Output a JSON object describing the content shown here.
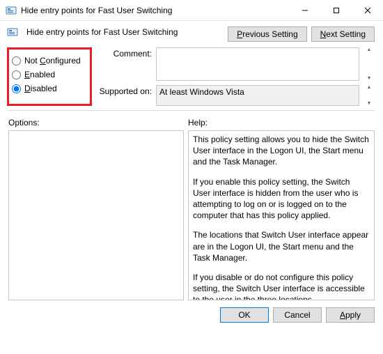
{
  "window": {
    "title": "Hide entry points for Fast User Switching",
    "minimize": "Minimize",
    "maximize": "Maximize",
    "close": "Close"
  },
  "header": {
    "title": "Hide entry points for Fast User Switching",
    "prev": "Previous Setting",
    "next": "Next Setting",
    "next_ul": "N"
  },
  "config": {
    "not_configured": "Not Configured",
    "not_configured_ul": "C",
    "enabled": "Enabled",
    "enabled_ul": "E",
    "disabled": "Disabled",
    "disabled_ul": "D",
    "selected": "disabled"
  },
  "fields": {
    "comment_label": "Comment:",
    "comment_value": "",
    "supported_label": "Supported on:",
    "supported_value": "At least Windows Vista"
  },
  "lower": {
    "options_label": "Options:",
    "help_label": "Help:"
  },
  "help_paragraphs": [
    "This policy setting allows you to hide the Switch User interface in the Logon UI, the Start menu and the Task Manager.",
    "If you enable this policy setting, the Switch User interface is hidden from the user who is attempting to log on or is logged on to the computer that has this policy applied.",
    "The locations that Switch User interface appear are in the Logon UI, the Start menu and the Task Manager.",
    "If you disable or do not configure this policy setting, the Switch User interface is accessible to the user in the three locations."
  ],
  "footer": {
    "ok": "OK",
    "cancel": "Cancel",
    "apply": "Apply",
    "apply_ul": "A"
  }
}
